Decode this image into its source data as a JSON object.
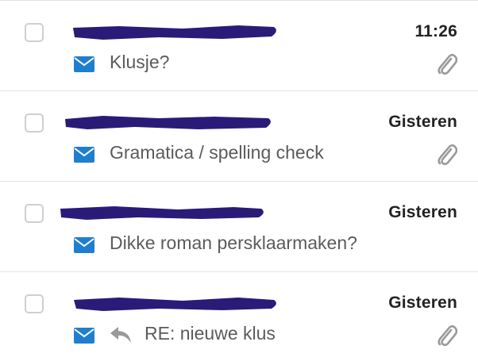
{
  "colors": {
    "accent_blue": "#1f7fce",
    "redaction": "#2b1b78",
    "divider": "#e3e3e3",
    "muted_icon": "#9a9a9a"
  },
  "messages": [
    {
      "date": "11:26",
      "subject": "Klusje?",
      "has_attachment": true,
      "is_reply": false,
      "unread_icon": "envelope-icon"
    },
    {
      "date": "Gisteren",
      "subject": "Gramatica / spelling check",
      "has_attachment": true,
      "is_reply": false,
      "unread_icon": "envelope-icon"
    },
    {
      "date": "Gisteren",
      "subject": "Dikke roman persklaarmaken?",
      "has_attachment": false,
      "is_reply": false,
      "unread_icon": "envelope-icon"
    },
    {
      "date": "Gisteren",
      "subject": "RE: nieuwe klus",
      "has_attachment": true,
      "is_reply": true,
      "unread_icon": "envelope-icon"
    }
  ]
}
